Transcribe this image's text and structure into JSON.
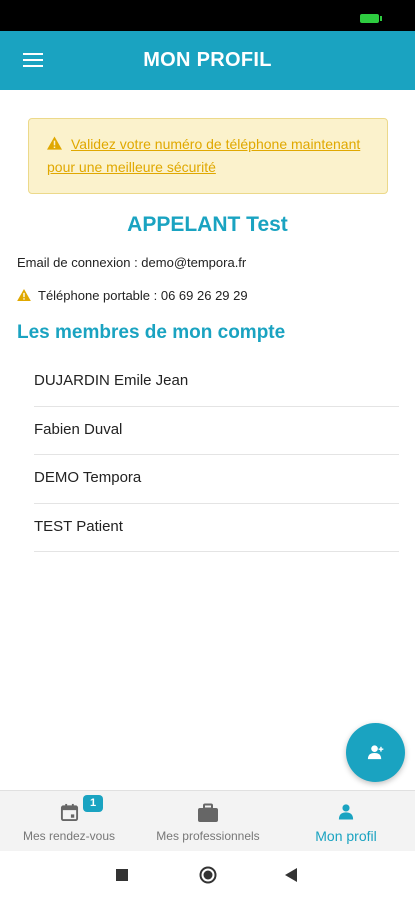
{
  "app_bar": {
    "title": "MON PROFIL",
    "menu_icon": "hamburger-menu-icon"
  },
  "alert": {
    "icon": "warning-icon",
    "text": "Validez votre numéro de téléphone maintenant pour une meilleure sécurité",
    "color": "#e0a800",
    "background": "#fbf2cc"
  },
  "profile": {
    "name": "APPELANT Test",
    "email_line": "Email de connexion : demo@tempora.fr",
    "phone_line": "Téléphone portable : 06 69 26 29 29"
  },
  "members": {
    "title": "Les membres de mon compte",
    "items": [
      {
        "label": "DUJARDIN Emile Jean"
      },
      {
        "label": "Fabien Duval"
      },
      {
        "label": "DEMO Tempora"
      },
      {
        "label": "TEST Patient"
      }
    ]
  },
  "fab": {
    "icon": "add-person-icon"
  },
  "bottom_nav": {
    "items": [
      {
        "label": "Mes rendez-vous",
        "icon": "calendar-icon",
        "badge": "1"
      },
      {
        "label": "Mes professionnels",
        "icon": "briefcase-icon"
      },
      {
        "label": "Mon profil",
        "icon": "person-icon",
        "active": true
      }
    ]
  },
  "system_nav": {
    "icons": [
      "square-recents-icon",
      "circle-home-icon",
      "triangle-back-icon"
    ]
  },
  "colors": {
    "accent": "#1aa3c1",
    "warning": "#e0a800",
    "status_bar": "#000000"
  }
}
